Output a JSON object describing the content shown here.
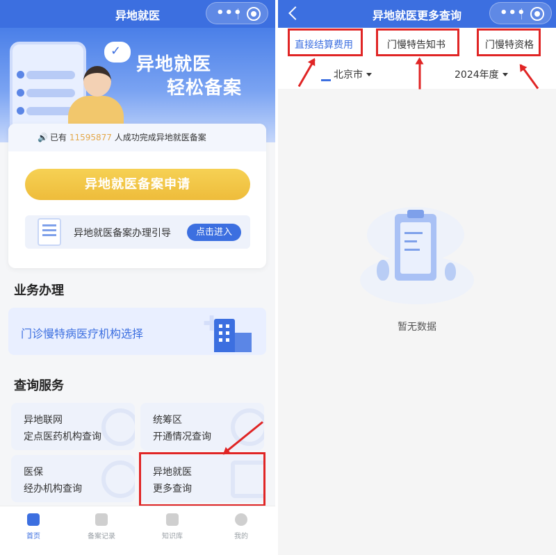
{
  "left": {
    "nav_title": "异地就医",
    "banner": {
      "title_line1": "异地就医",
      "title_line2": "轻松备案"
    },
    "notice": {
      "prefix": "已有",
      "count": "11595877",
      "suffix": "人成功完成异地就医备案"
    },
    "apply_button": "异地就医备案申请",
    "guide": {
      "label": "异地就医备案办理引导",
      "button": "点击进入"
    },
    "section_business": "业务办理",
    "business_item": "门诊慢特病医疗机构选择",
    "section_query": "查询服务",
    "query_cards": [
      {
        "line1": "异地联网",
        "line2": "定点医药机构查询"
      },
      {
        "line1": "统筹区",
        "line2": "开通情况查询"
      },
      {
        "line1": "医保",
        "line2": "经办机构查询"
      },
      {
        "line1": "异地就医",
        "line2": "更多查询"
      }
    ],
    "tabbar": [
      {
        "label": "首页",
        "active": true
      },
      {
        "label": "备案记录",
        "active": false
      },
      {
        "label": "知识库",
        "active": false
      },
      {
        "label": "我的",
        "active": false
      }
    ]
  },
  "right": {
    "nav_title": "异地就医更多查询",
    "tabs": [
      {
        "label": "直接结算费用",
        "active": true
      },
      {
        "label": "门慢特告知书",
        "active": false
      },
      {
        "label": "门慢特资格",
        "active": false
      }
    ],
    "city_select": "北京市",
    "year_select": "2024年度",
    "empty_text": "暂无数据"
  },
  "colors": {
    "primary": "#3c6fe0",
    "accent_yellow": "#f1c545",
    "highlight_red": "#e02525"
  }
}
